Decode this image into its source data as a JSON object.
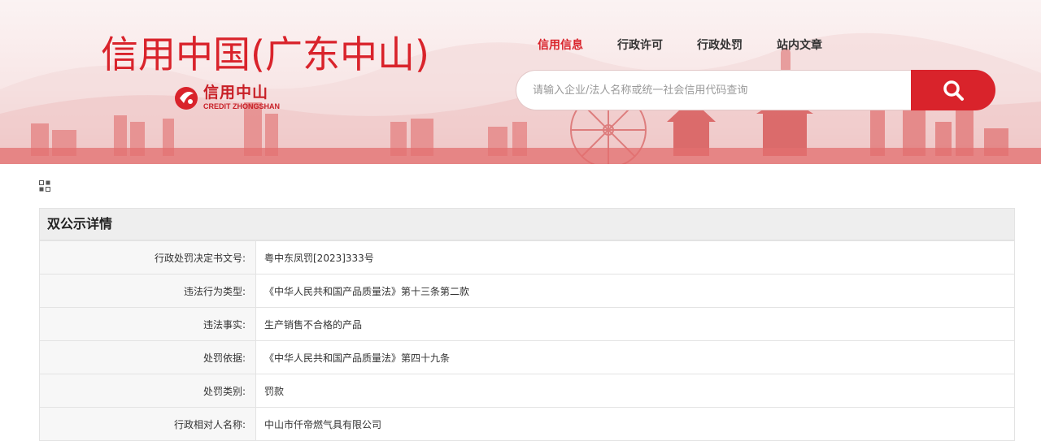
{
  "header": {
    "site_title": "信用中国(广东中山)",
    "logo_cn": "信用中山",
    "logo_en": "CREDIT ZHONGSHAN",
    "nav": [
      {
        "label": "信用信息",
        "active": true
      },
      {
        "label": "行政许可",
        "active": false
      },
      {
        "label": "行政处罚",
        "active": false
      },
      {
        "label": "站内文章",
        "active": false
      }
    ],
    "search": {
      "placeholder": "请输入企业/法人名称或统一社会信用代码查询",
      "icon": "search-icon"
    }
  },
  "colors": {
    "brand_red": "#d9232b",
    "banner_bg": "#f8e6e6",
    "header_gray": "#eeeeee"
  },
  "panel": {
    "title": "双公示详情",
    "rows": [
      {
        "label": "行政处罚决定书文号:",
        "value": "粤中东凤罚[2023]333号"
      },
      {
        "label": "违法行为类型:",
        "value": "《中华人民共和国产品质量法》第十三条第二款"
      },
      {
        "label": "违法事实:",
        "value": "生产销售不合格的产品"
      },
      {
        "label": "处罚依据:",
        "value": "《中华人民共和国产品质量法》第四十九条"
      },
      {
        "label": "处罚类别:",
        "value": "罚款"
      },
      {
        "label": "行政相对人名称:",
        "value": "中山市仟帝燃气具有限公司"
      }
    ]
  }
}
